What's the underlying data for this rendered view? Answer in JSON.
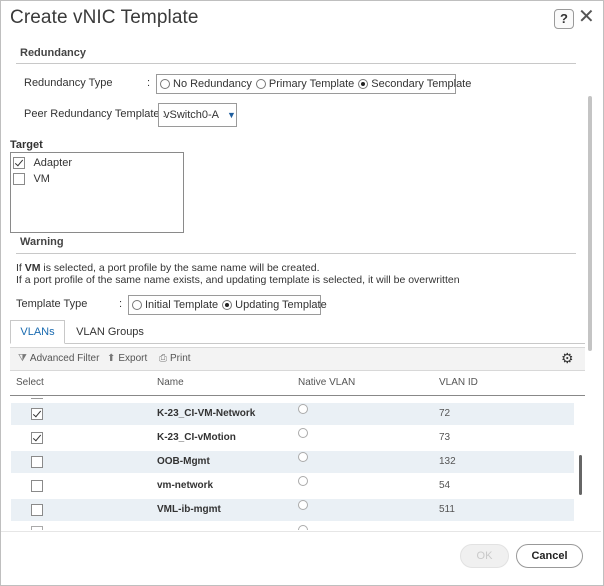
{
  "dialog": {
    "title": "Create vNIC Template",
    "help_label": "?",
    "close_label": "✕"
  },
  "redundancy": {
    "heading": "Redundancy",
    "type_label": "Redundancy Type",
    "type_colon": ":",
    "options": [
      "No Redundancy",
      "Primary Template",
      "Secondary Template"
    ],
    "selected": "Secondary Template",
    "peer_label": "Peer Redundancy Template :",
    "peer_value": "vSwitch0-A"
  },
  "target": {
    "heading": "Target",
    "items": [
      {
        "label": "Adapter",
        "checked": true
      },
      {
        "label": "VM",
        "checked": false
      }
    ]
  },
  "warning": {
    "heading": "Warning",
    "line1_prefix": "If ",
    "line1_bold": "VM",
    "line1_suffix": " is selected, a port profile by the same name will be created.",
    "line2": "If a port profile of the same name exists, and updating template is selected, it will be overwritten"
  },
  "template_type": {
    "label": "Template Type",
    "colon": ":",
    "options": [
      "Initial Template",
      "Updating Template"
    ],
    "selected": "Updating Template"
  },
  "tabs": [
    {
      "label": "VLANs",
      "active": true
    },
    {
      "label": "VLAN Groups",
      "active": false
    }
  ],
  "toolbar": {
    "advanced_filter": "Advanced Filter",
    "export": "Export",
    "print": "Print"
  },
  "table": {
    "headers": [
      "Select",
      "Name",
      "Native VLAN",
      "VLAN ID"
    ],
    "rows": [
      {
        "name": "K-23_CI-VM-Network",
        "checked": true,
        "native": false,
        "vlan_id": "72"
      },
      {
        "name": "K-23_CI-vMotion",
        "checked": true,
        "native": false,
        "vlan_id": "73"
      },
      {
        "name": "OOB-Mgmt",
        "checked": false,
        "native": false,
        "vlan_id": "132"
      },
      {
        "name": "vm-network",
        "checked": false,
        "native": false,
        "vlan_id": "54"
      },
      {
        "name": "VML-ib-mgmt",
        "checked": false,
        "native": false,
        "vlan_id": "511"
      }
    ]
  },
  "footer": {
    "ok_label": "OK",
    "cancel_label": "Cancel"
  },
  "colors": {
    "accent": "#1a6bb0",
    "row_alt": "#eaf0f5"
  },
  "icons": [
    "help-icon",
    "close-icon",
    "filter-icon",
    "export-icon",
    "print-icon",
    "gear-icon",
    "chevron-down-icon",
    "checkbox-icon",
    "radio-icon"
  ]
}
